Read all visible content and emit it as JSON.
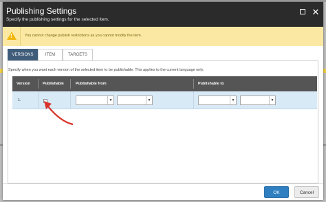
{
  "dialog": {
    "title": "Publishing Settings",
    "subtitle": "Specify the publishing settings for the selected item."
  },
  "warning": {
    "text": "You cannot change publish restrictions as you cannot modify the item.",
    "icon": "warning-icon"
  },
  "tabs": [
    {
      "label": "VERSIONS",
      "active": true
    },
    {
      "label": "ITEM",
      "active": false
    },
    {
      "label": "TARGETS",
      "active": false
    }
  ],
  "description": "Specify when you want each version of the selected item to be publishable. This applies to the current language only.",
  "grid": {
    "columns": [
      "Version",
      "Publishable",
      "Publishable from",
      "Publishable to"
    ],
    "rows": [
      {
        "version": "1.",
        "publishable": false,
        "from_date": "",
        "from_time": "",
        "to_date": "",
        "to_time": ""
      }
    ]
  },
  "buttons": {
    "ok": "OK",
    "cancel": "Cancel"
  },
  "colors": {
    "titlebar": "#2b2b2b",
    "warning_bg": "#fbe9a3",
    "active_tab": "#3f5c7a",
    "grid_header": "#555555",
    "row_selected": "#d9eaf7",
    "ok_button": "#2f7fc1",
    "annotation_arrow": "#d9342b"
  }
}
